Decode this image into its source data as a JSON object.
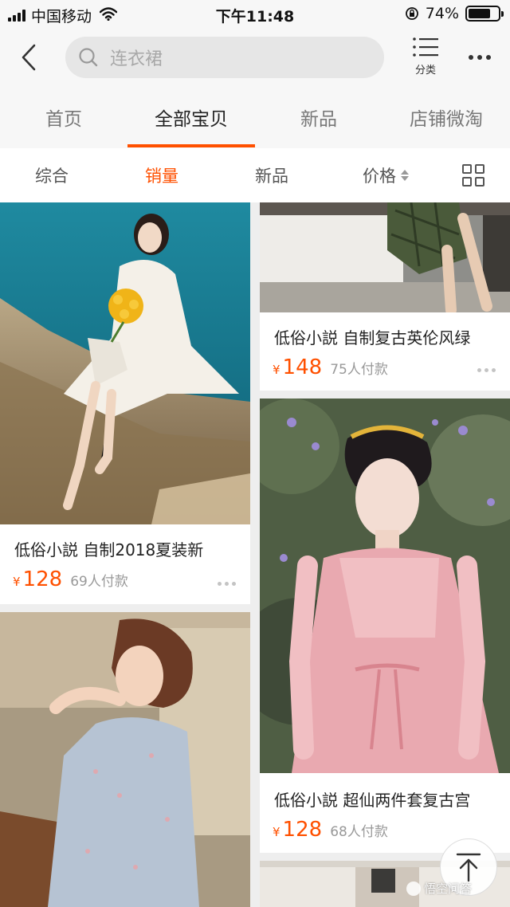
{
  "status_bar": {
    "carrier": "中国移动",
    "time": "下午11:48",
    "battery_percent_label": "74%",
    "battery_level": 0.74
  },
  "header": {
    "search_placeholder": "连衣裙",
    "category_label": "分类"
  },
  "shop_tabs": [
    {
      "label": "首页",
      "active": false
    },
    {
      "label": "全部宝贝",
      "active": true
    },
    {
      "label": "新品",
      "active": false
    },
    {
      "label": "店铺微淘",
      "active": false
    }
  ],
  "sort_bar": {
    "items": [
      {
        "label": "综合",
        "active": false
      },
      {
        "label": "销量",
        "active": true
      },
      {
        "label": "新品",
        "active": false
      },
      {
        "label": "价格",
        "active": false
      }
    ]
  },
  "products": [
    {
      "title": "低俗小説 自制2018夏装新",
      "currency": "¥",
      "price": "128",
      "sales": "69人付款"
    },
    {
      "title": "低俗小説 自制复古英伦风绿",
      "currency": "¥",
      "price": "148",
      "sales": "75人付款"
    },
    {
      "title": "低俗小説 超仙两件套复古宫",
      "currency": "¥",
      "price": "128",
      "sales": "68人付款"
    }
  ],
  "watermark": "悟空问答",
  "colors": {
    "accent": "#ff5000",
    "page_background": "#eeeeee",
    "header_background": "#f7f7f7"
  }
}
